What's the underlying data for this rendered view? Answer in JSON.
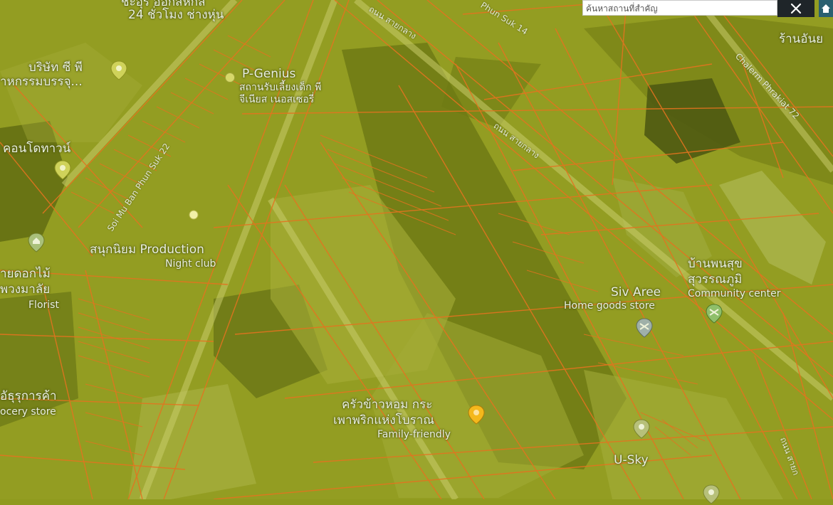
{
  "search": {
    "placeholder": "ค้นหาสถานที่สำคัญ"
  },
  "controls": {
    "close_icon": "close-icon",
    "home_icon": "home-icon"
  },
  "colors": {
    "map_tint": "#8f9a1e",
    "parcel_line": "#e4731f",
    "road_label": "#e5ead4",
    "pin_fill": "#e8e86a",
    "pin_food": "#f4b81c"
  },
  "places": {
    "p1_line1": "ชะอุร ออกสหกล",
    "p1_line2": "24 ชั่วโมง ช่างหุ่น",
    "p2_line1": "บริษัท ซี พี",
    "p2_line2": "าหกรรมบรรจุ...",
    "p3_line1": "P-Genius",
    "p3_line2": "สถานรับเลี้ยงเด็ก พี",
    "p3_line3": "จีเนียส เนอสเซอรี่",
    "p4_line1": "คอนโดทาวน์",
    "p5_line1": "สนุกนิยม Production",
    "p5_line2": "Night club",
    "p6_line1": "ายดอกไม้",
    "p6_line2": "พวงมาลัย",
    "p6_line3": "Florist",
    "p7_line1": "อัธุรุการค้า",
    "p7_line2": "ocery store",
    "p8_line1": "ครัวข้าวหอม กระ",
    "p8_line2": "เพาพริกแห่งโบราณ",
    "p8_line3": "Family-friendly",
    "p9_line1": "Siv Aree",
    "p9_line2": "Home goods store",
    "p10_line1": "บ้านพนสุข",
    "p10_line2": "สุวรรณภูมิ",
    "p10_line3": "Community center",
    "p11_line1": "U-Sky",
    "p12_line1": "ร้านอันย"
  },
  "roads": {
    "r1": "ถนน สายกลาง",
    "r2": "ถนน สายกลาง",
    "r3": "Phun Suk 14",
    "r4": "Soi Mu Ban Phun Suk 22",
    "r5": "Chalerm Phrakiat 72",
    "r6": "ถนน สายก"
  }
}
